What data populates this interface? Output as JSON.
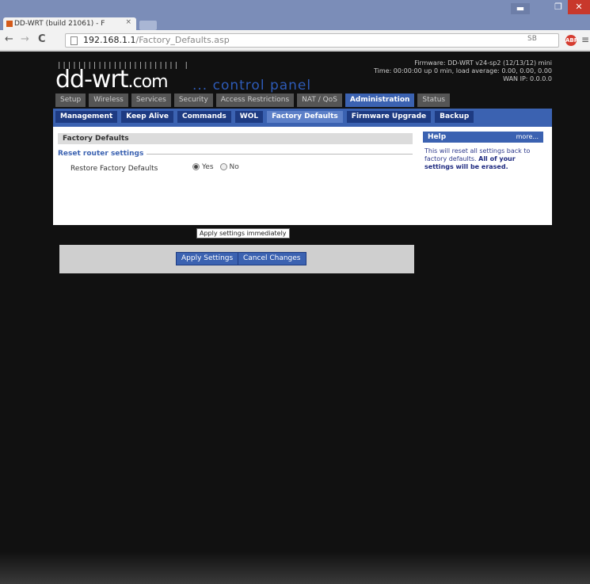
{
  "browser": {
    "tab_title": "DD-WRT (build 21061) - F",
    "tab_close": "×",
    "url_host": "192.168.1.1",
    "url_path": "/Factory_Defaults.asp",
    "nav_back": "←",
    "nav_forward": "→",
    "nav_reload": "C",
    "ext_label": "SB",
    "menu": "≡",
    "win_min": "▬",
    "win_max": "❐",
    "win_close": "✕"
  },
  "header": {
    "bars": "||||||||||||||||||||||||  |",
    "logo_main": "dd-wrt",
    "logo_suffix": ".com",
    "tagline": "... control panel",
    "firmware": "Firmware: DD-WRT v24-sp2 (12/13/12) mini",
    "time": "Time: 00:00:00 up 0 min, load average: 0.00, 0.00, 0.00",
    "wan": "WAN IP: 0.0.0.0"
  },
  "main_tabs": [
    {
      "label": "Setup"
    },
    {
      "label": "Wireless"
    },
    {
      "label": "Services"
    },
    {
      "label": "Security"
    },
    {
      "label": "Access Restrictions"
    },
    {
      "label": "NAT / QoS"
    },
    {
      "label": "Administration"
    },
    {
      "label": "Status"
    }
  ],
  "sub_tabs": [
    {
      "label": "Management"
    },
    {
      "label": "Keep Alive"
    },
    {
      "label": "Commands"
    },
    {
      "label": "WOL"
    },
    {
      "label": "Factory Defaults"
    },
    {
      "label": "Firmware Upgrade"
    },
    {
      "label": "Backup"
    }
  ],
  "content": {
    "section_title": "Factory Defaults",
    "legend": "Reset router settings",
    "field_label": "Restore Factory Defaults",
    "radio_yes": "Yes",
    "radio_no": "No",
    "selected": "Yes",
    "apply_button": "Apply Settings",
    "cancel_button": "Cancel Changes"
  },
  "help": {
    "title": "Help",
    "more": "more...",
    "text_pre": "This will reset all settings back to factory defaults. ",
    "text_strong": "All of your settings will be erased."
  },
  "tooltip": "Apply settings immediately"
}
